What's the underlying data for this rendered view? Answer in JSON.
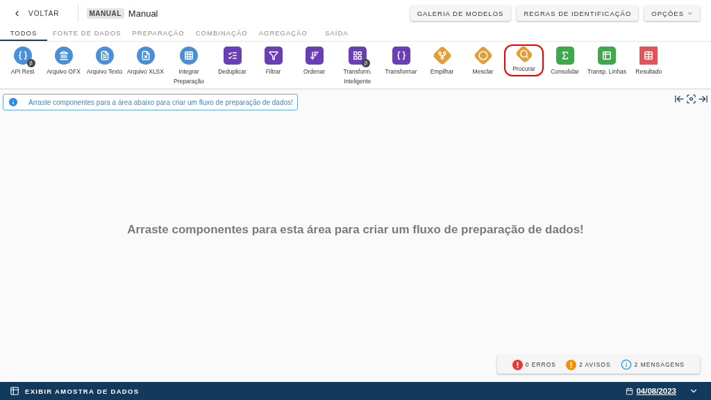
{
  "header": {
    "back": "VOLTAR",
    "tag": "MANUAL",
    "title": "Manual",
    "buttons": [
      "GALERIA DE MODELOS",
      "REGRAS DE IDENTIFICAÇÃO"
    ],
    "options": "OPÇÕES"
  },
  "tabs": [
    {
      "label": "TODOS",
      "selected": true
    },
    {
      "label": "FONTE DE DADOS",
      "selected": false
    },
    {
      "label": "PREPARAÇÃO",
      "selected": false
    },
    {
      "label": "COMBINAÇÃO",
      "selected": false
    },
    {
      "label": "AGREGAÇÃO",
      "selected": false
    },
    {
      "label": "SAÍDA",
      "selected": false
    }
  ],
  "tools": [
    {
      "label": "API Rest",
      "kind": "circle",
      "color": "#4a90d9",
      "badge": "β",
      "selected": false
    },
    {
      "label": "Arquivo OFX",
      "kind": "circle",
      "color": "#4a90d9",
      "selected": false
    },
    {
      "label": "Arquivo Texto",
      "kind": "circle",
      "color": "#4a90d9",
      "selected": false
    },
    {
      "label": "Arquivo XLSX",
      "kind": "circle",
      "color": "#4a90d9",
      "selected": false
    },
    {
      "label": "Integrar Preparação",
      "kind": "circle",
      "color": "#4a90d9",
      "selected": false
    },
    {
      "label": "Deduplicar",
      "kind": "square",
      "color": "#6a3fb5",
      "selected": false
    },
    {
      "label": "Filtrar",
      "kind": "square",
      "color": "#6a3fb5",
      "selected": false
    },
    {
      "label": "Ordenar",
      "kind": "square",
      "color": "#6a3fb5",
      "selected": false
    },
    {
      "label": "Transform. Inteligente",
      "kind": "square",
      "color": "#6a3fb5",
      "badge": "β",
      "selected": false
    },
    {
      "label": "Transformar",
      "kind": "square",
      "color": "#6a3fb5",
      "selected": false
    },
    {
      "label": "Empilhar",
      "kind": "diamond",
      "color": "#e39e36",
      "selected": false
    },
    {
      "label": "Mesclar",
      "kind": "diamond",
      "color": "#e39e36",
      "selected": false
    },
    {
      "label": "Procurar",
      "kind": "diamond",
      "color": "#e39e36",
      "selected": true
    },
    {
      "label": "Consolidar",
      "kind": "square",
      "color": "#3fa84a",
      "selected": false
    },
    {
      "label": "Transp. Linhas",
      "kind": "square",
      "color": "#3fa84a",
      "selected": false
    },
    {
      "label": "Resultado",
      "kind": "flat",
      "color": "#e0555a",
      "selected": false
    }
  ],
  "hint": "Arraste componentes para a área abaixo para criar um fluxo de preparação de dados!",
  "canvas_message": "Arraste componentes para esta área para criar um fluxo de preparação de dados!",
  "status": [
    {
      "kind": "error",
      "label": "0 ERROS",
      "color": "#e53935"
    },
    {
      "kind": "warning",
      "label": "2 AVISOS",
      "color": "#fb8c00"
    },
    {
      "kind": "info",
      "label": "2 MENSAGENS",
      "color": "#2196f3"
    }
  ],
  "footer": {
    "label": "EXIBIR AMOSTRA DE DADOS",
    "date": "04/08/2023"
  }
}
